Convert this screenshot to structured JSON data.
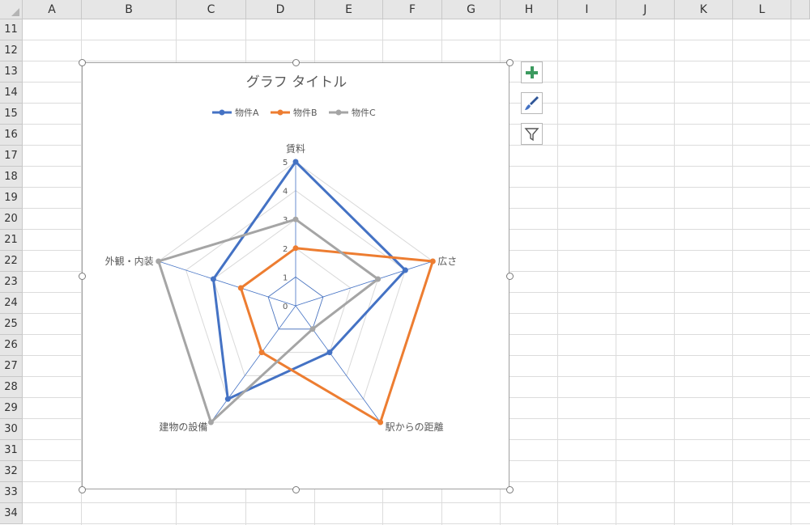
{
  "sheet": {
    "columns": [
      "A",
      "B",
      "C",
      "D",
      "E",
      "F",
      "G",
      "H",
      "I",
      "J",
      "K",
      "L"
    ],
    "rows": [
      "11",
      "12",
      "13",
      "14",
      "15",
      "16",
      "17",
      "18",
      "19",
      "20",
      "21",
      "22",
      "23",
      "24",
      "25",
      "26",
      "27",
      "28",
      "29",
      "30",
      "31",
      "32",
      "33",
      "34"
    ]
  },
  "chart_buttons": [
    {
      "icon": "plus-icon",
      "color": "#2e8b57"
    },
    {
      "icon": "brush-icon",
      "color": "#2f5597"
    },
    {
      "icon": "filter-icon",
      "color": "#555555"
    }
  ],
  "chart_data": {
    "type": "radar",
    "title": "グラフ タイトル",
    "categories": [
      "賃料",
      "広さ",
      "駅からの距離",
      "建物の設備",
      "外観・内装"
    ],
    "rlim": [
      0,
      5
    ],
    "ticks": [
      "0",
      "1",
      "2",
      "3",
      "4",
      "5"
    ],
    "legend_position": "top",
    "series": [
      {
        "name": "物件A",
        "color": "#4472c4",
        "values": [
          5,
          4,
          2,
          4,
          3
        ]
      },
      {
        "name": "物件B",
        "color": "#ed7d31",
        "values": [
          2,
          5,
          5,
          2,
          2
        ]
      },
      {
        "name": "物件C",
        "color": "#a5a5a5",
        "values": [
          3,
          3,
          1,
          5,
          5
        ]
      }
    ]
  }
}
